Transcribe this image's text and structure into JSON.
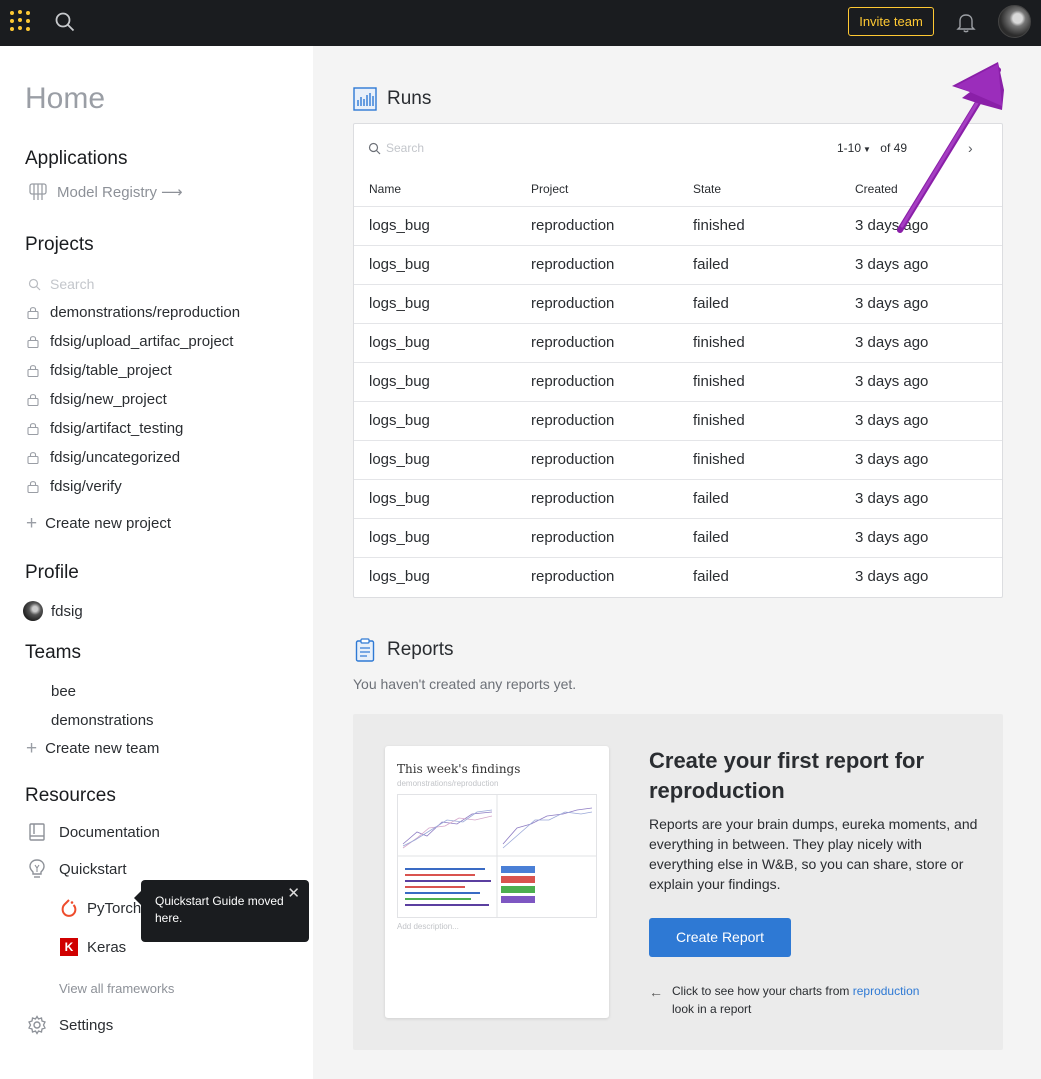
{
  "topbar": {
    "invite_label": "Invite team",
    "icons": [
      "wandb-logo-icon",
      "search-icon",
      "bell-icon",
      "avatar"
    ]
  },
  "sidebar": {
    "home_title": "Home",
    "applications_title": "Applications",
    "model_registry": "Model Registry",
    "projects_title": "Projects",
    "projects_search_placeholder": "Search",
    "projects": [
      "demonstrations/reproduction",
      "fdsig/upload_artifac_project",
      "fdsig/table_project",
      "fdsig/new_project",
      "fdsig/artifact_testing",
      "fdsig/uncategorized",
      "fdsig/verify"
    ],
    "create_project": "Create new project",
    "profile_title": "Profile",
    "profile_name": "fdsig",
    "teams_title": "Teams",
    "teams": [
      "bee",
      "demonstrations"
    ],
    "create_team": "Create new team",
    "resources_title": "Resources",
    "documentation": "Documentation",
    "quickstart": "Quickstart",
    "pytorch": "PyTorch",
    "keras": "Keras",
    "view_all": "View all frameworks",
    "settings": "Settings",
    "tooltip": "Quickstart Guide moved here."
  },
  "runs": {
    "title": "Runs",
    "search_placeholder": "Search",
    "page_range": "1-10",
    "page_total": "of 49",
    "headers": [
      "Name",
      "Project",
      "State",
      "Created"
    ],
    "rows": [
      [
        "logs_bug",
        "reproduction",
        "finished",
        "3 days ago"
      ],
      [
        "logs_bug",
        "reproduction",
        "failed",
        "3 days ago"
      ],
      [
        "logs_bug",
        "reproduction",
        "failed",
        "3 days ago"
      ],
      [
        "logs_bug",
        "reproduction",
        "finished",
        "3 days ago"
      ],
      [
        "logs_bug",
        "reproduction",
        "finished",
        "3 days ago"
      ],
      [
        "logs_bug",
        "reproduction",
        "finished",
        "3 days ago"
      ],
      [
        "logs_bug",
        "reproduction",
        "finished",
        "3 days ago"
      ],
      [
        "logs_bug",
        "reproduction",
        "failed",
        "3 days ago"
      ],
      [
        "logs_bug",
        "reproduction",
        "failed",
        "3 days ago"
      ],
      [
        "logs_bug",
        "reproduction",
        "failed",
        "3 days ago"
      ]
    ]
  },
  "reports": {
    "title": "Reports",
    "empty_text": "You haven't created any reports yet.",
    "preview_title": "This week's findings",
    "preview_sub": "demonstrations/reproduction",
    "preview_desc": "Add description...",
    "cta_heading": "Create your first report for reproduction",
    "cta_body": "Reports are your brain dumps, eureka moments, and everything in between. They play nicely with everything else in W&B, so you can share, store or explain your findings.",
    "create_button": "Create Report",
    "hint_prefix": "Click to see how your charts from ",
    "hint_link": "reproduction",
    "hint_suffix": " look in a report"
  },
  "colors": {
    "topbar": "#1a1c1f",
    "accent_yellow": "#ffc933",
    "primary_blue": "#2e79d4",
    "annotation_purple": "#8a1fa8"
  }
}
